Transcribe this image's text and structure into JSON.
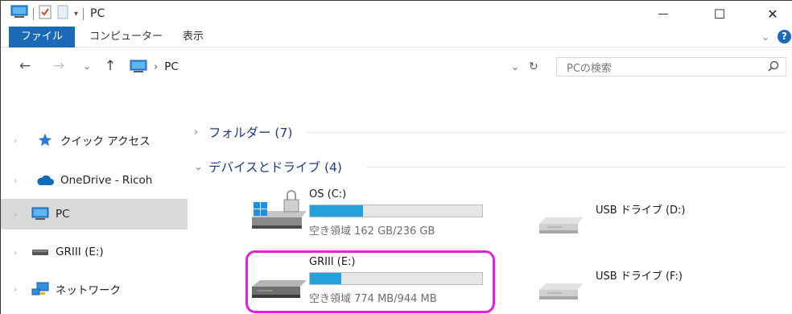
{
  "titlebar": {
    "title": "PC",
    "minimize_glyph": "—",
    "maximize_glyph": "☐",
    "close_glyph": "✕"
  },
  "ribbon": {
    "tabs": [
      {
        "label": "ファイル"
      },
      {
        "label": "コンピューター"
      },
      {
        "label": "表示"
      }
    ],
    "expand_glyph": "⌄",
    "help_glyph": "?"
  },
  "address": {
    "back_glyph": "←",
    "forward_glyph": "→",
    "recent_glyph": "⌄",
    "up_glyph": "↑",
    "path_separator": "›",
    "path": "PC",
    "dropdown_glyph": "⌄",
    "refresh_glyph": "↻",
    "search_placeholder": "PCの検索"
  },
  "sidebar": {
    "items": [
      {
        "label": "クイック アクセス",
        "icon": "star-icon"
      },
      {
        "label": "OneDrive - Ricoh",
        "icon": "cloud-icon"
      },
      {
        "label": "PC",
        "icon": "monitor-icon",
        "selected": true
      },
      {
        "label": "GRIII (E:)",
        "icon": "usb-drive-icon"
      },
      {
        "label": "ネットワーク",
        "icon": "network-icon"
      }
    ]
  },
  "groups": {
    "folders": {
      "label": "フォルダー (7)",
      "expanded": false
    },
    "devices": {
      "label": "デバイスとドライブ (4)",
      "expanded": true
    }
  },
  "drives": [
    {
      "name": "OS (C:)",
      "free_text": "空き領域 162 GB/236 GB",
      "used_fraction": 0.31,
      "icon": "windows-drive-icon"
    },
    {
      "name": "USB ドライブ (D:)",
      "icon": "removable-drive-icon"
    },
    {
      "name": "GRIII (E:)",
      "free_text": "空き領域 774 MB/944 MB",
      "used_fraction": 0.18,
      "icon": "hard-drive-icon"
    },
    {
      "name": "USB ドライブ (F:)",
      "icon": "removable-drive-icon"
    }
  ],
  "colors": {
    "accent": "#1a6ab8",
    "bar_fill": "#26a0da",
    "highlight": "#e51ee5",
    "group_header": "#1e3a87"
  }
}
